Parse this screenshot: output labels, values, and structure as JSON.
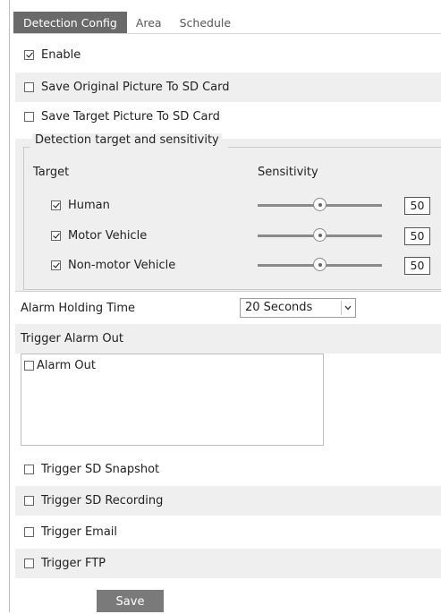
{
  "tabs": [
    {
      "label": "Detection Config",
      "active": true
    },
    {
      "label": "Area",
      "active": false
    },
    {
      "label": "Schedule",
      "active": false
    }
  ],
  "options": {
    "enable": {
      "label": "Enable",
      "checked": true
    },
    "save_original": {
      "label": "Save Original Picture To SD Card",
      "checked": false
    },
    "save_target": {
      "label": "Save Target Picture To SD Card",
      "checked": false
    }
  },
  "detection": {
    "legend": "Detection target and sensitivity",
    "target_header": "Target",
    "sensitivity_header": "Sensitivity",
    "targets": [
      {
        "label": "Human",
        "checked": true,
        "sensitivity": "50",
        "slider_fraction": 0.5
      },
      {
        "label": "Motor Vehicle",
        "checked": true,
        "sensitivity": "50",
        "slider_fraction": 0.5
      },
      {
        "label": "Non-motor Vehicle",
        "checked": true,
        "sensitivity": "50",
        "slider_fraction": 0.5
      }
    ]
  },
  "alarm_holding": {
    "label": "Alarm Holding Time",
    "value": "20 Seconds"
  },
  "trigger_alarm_out": {
    "label": "Trigger Alarm Out",
    "items": [
      {
        "label": "Alarm Out",
        "checked": false
      }
    ]
  },
  "triggers": [
    {
      "label": "Trigger SD Snapshot",
      "checked": false
    },
    {
      "label": "Trigger SD Recording",
      "checked": false
    },
    {
      "label": "Trigger Email",
      "checked": false
    },
    {
      "label": "Trigger FTP",
      "checked": false
    }
  ],
  "save_label": "Save",
  "colors": {
    "tab_active_bg": "#6a6a6a",
    "row_shade": "#efefef",
    "button_bg": "#7a7a7a"
  },
  "icons": {
    "checkbox": "checkbox-icon",
    "dropdown": "chevron-down-icon",
    "slider_thumb": "slider-thumb-icon"
  }
}
